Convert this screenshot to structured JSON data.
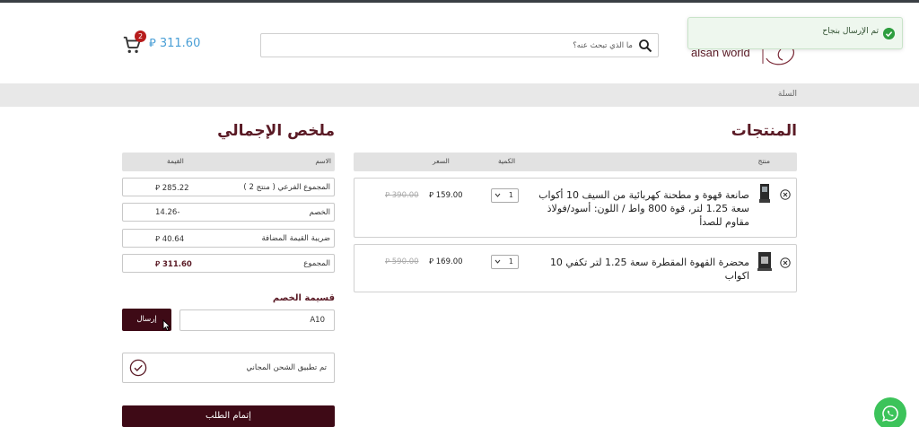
{
  "colors": {
    "brand": "#5a1a25",
    "button_dark": "#3e0a16",
    "cart_total": "#4a9fd6",
    "success": "#2e9e3f",
    "whatsapp": "#3cc35a"
  },
  "header": {
    "cart_total": "311.60 ⃁",
    "cart_count": "2",
    "search_placeholder": "ما الذي تبحث عنه؟",
    "logo_text": "alsan world"
  },
  "toast": {
    "message": "تم الإرسال بنجاح"
  },
  "breadcrumb": {
    "current": "السلة"
  },
  "products": {
    "title": "المنتجات",
    "headers": {
      "product": "منتج",
      "quantity": "الكمية",
      "price": "السعر"
    },
    "items": [
      {
        "name": "صانعة قهوة و مطحنة كهربائية من السيف 10 أكواب سعة 1.25 لتر، قوة 800 واط / اللون: أسود/فولاذ مقاوم للصدأ",
        "quantity": "1",
        "price": "159.00 ⃁",
        "old_price": "390.00 ⃁"
      },
      {
        "name": "محضرة القهوة المقطرة سعة 1.25 لتر تكفي 10 اكواب",
        "quantity": "1",
        "price": "169.00 ⃁",
        "old_price": "590.00 ⃁"
      }
    ]
  },
  "summary": {
    "title": "ملخص الإجمالي",
    "headers": {
      "name": "الاسم",
      "value": "القيمة"
    },
    "rows": [
      {
        "label": "المجموع الفرعي ( منتج 2 )",
        "value": "285.22 ⃁"
      },
      {
        "label": "الخصم",
        "value": "-14.26"
      },
      {
        "label": "ضريبة القيمة المضافة",
        "value": "40.64 ⃁"
      },
      {
        "label": "المجموع",
        "value": "311.60 ⃁"
      }
    ],
    "coupon_label": "قسيمة الخصم",
    "coupon_value": "A10",
    "coupon_button": "إرسال",
    "free_shipping": "تم تطبيق الشحن المجاني",
    "checkout_button": "إتمام الطلب"
  }
}
